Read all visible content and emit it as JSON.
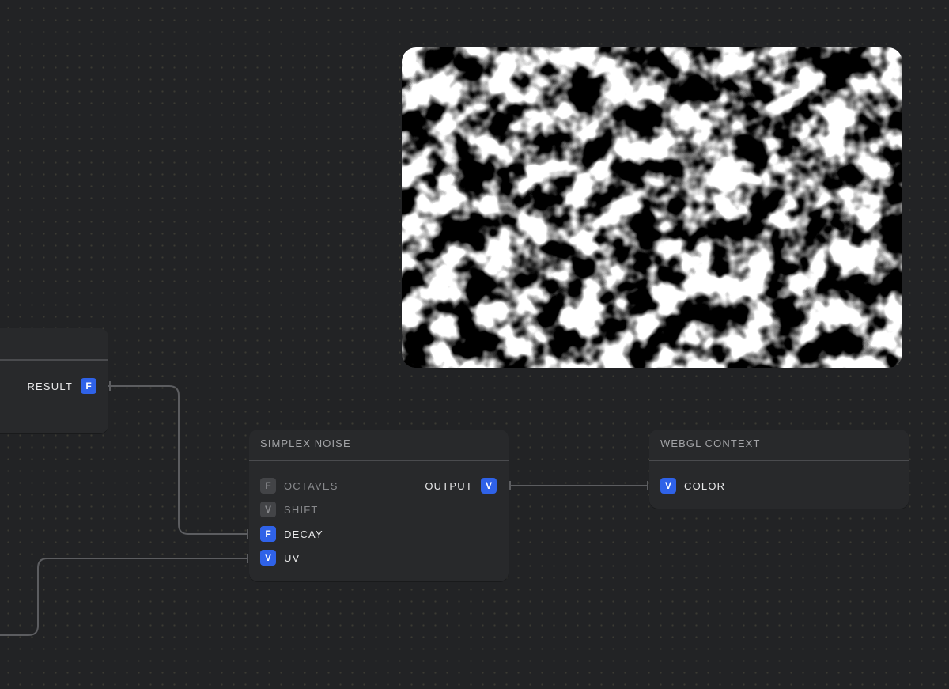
{
  "colors": {
    "background": "#222325",
    "node_bg": "#28292b",
    "accent": "#2f62e8",
    "wire": "#5c5d60"
  },
  "result_node": {
    "output": {
      "label": "RESULT",
      "type": "F"
    }
  },
  "simplex_node": {
    "title": "SIMPLEX NOISE",
    "inputs": [
      {
        "label": "OCTAVES",
        "type": "F",
        "connected": false
      },
      {
        "label": "SHIFT",
        "type": "V",
        "connected": false
      },
      {
        "label": "DECAY",
        "type": "F",
        "connected": true
      },
      {
        "label": "UV",
        "type": "V",
        "connected": true
      }
    ],
    "output": {
      "label": "OUTPUT",
      "type": "V"
    }
  },
  "webgl_node": {
    "title": "WEBGL CONTEXT",
    "inputs": [
      {
        "label": "COLOR",
        "type": "V",
        "connected": true
      }
    ]
  },
  "preview": {
    "content": "simplex-noise-render"
  }
}
